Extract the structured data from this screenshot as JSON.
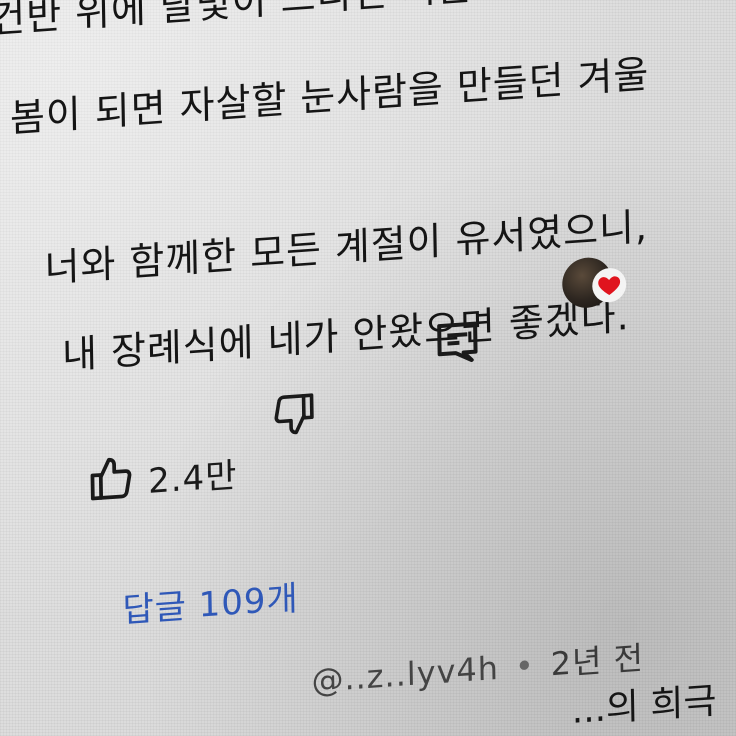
{
  "comment": {
    "paragraph1": [
      "건반 위에 달빛이 느리던 겨울",
      "봄이 되면 자살할 눈사람을 만들던 겨울"
    ],
    "paragraph2": [
      "너와 함께한 모든 계절이 유서였으니,",
      "내 장례식에 네가 안왔으면 좋겠다."
    ]
  },
  "actions": {
    "like_count": "2.4만",
    "like_icon": "thumbs-up-icon",
    "dislike_icon": "thumbs-down-icon",
    "reply_icon": "reply-icon",
    "heart_icon": "heart-icon",
    "heart_color": "#e0141e"
  },
  "replies": {
    "label": "답글 109개",
    "color": "#2f58b8"
  },
  "next_comment": {
    "handle": "@..z..lyv4h",
    "separator": "•",
    "time": "2년 전",
    "text": "...의 희극"
  }
}
